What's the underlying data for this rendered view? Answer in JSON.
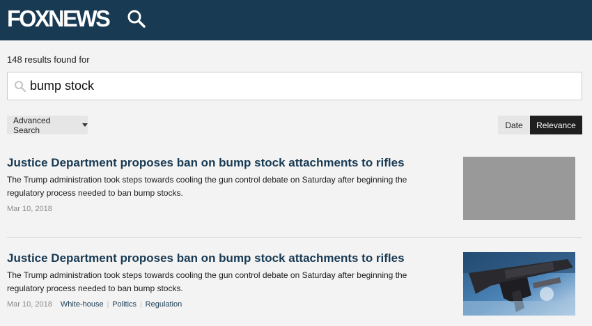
{
  "header": {
    "logo_text": "FOXNEWS",
    "search_icon": "search-icon",
    "background": "#183a53"
  },
  "search": {
    "results_label": "148 results found for",
    "query": "bump stock",
    "placeholder": ""
  },
  "controls": {
    "advanced_label": "Advanced Search",
    "sort_date_label": "Date",
    "sort_relevance_label": "Relevance",
    "active_sort": "Relevance"
  },
  "articles": [
    {
      "title": "Justice Department proposes ban on bump stock attachments to rifles",
      "description": "The Trump administration took steps towards cooling the gun control debate on Saturday after beginning the regulatory process needed to ban bump stocks.",
      "date": "Mar 10, 2018",
      "tags": [],
      "thumbnail": "gray-placeholder"
    },
    {
      "title": "Justice Department proposes ban on bump stock attachments to rifles",
      "description": "The Trump administration took steps towards cooling the gun control debate on Saturday after beginning the regulatory process needed to ban bump stocks.",
      "date": "Mar 10, 2018",
      "tags": [
        "White-house",
        "Politics",
        "Regulation"
      ],
      "thumbnail": "rifle-bump-stock-photo"
    }
  ],
  "colors": {
    "brand": "#183a53",
    "title": "#183a53",
    "active_sort_bg": "#1f1f1f",
    "page_bg": "#f3f3f3"
  }
}
